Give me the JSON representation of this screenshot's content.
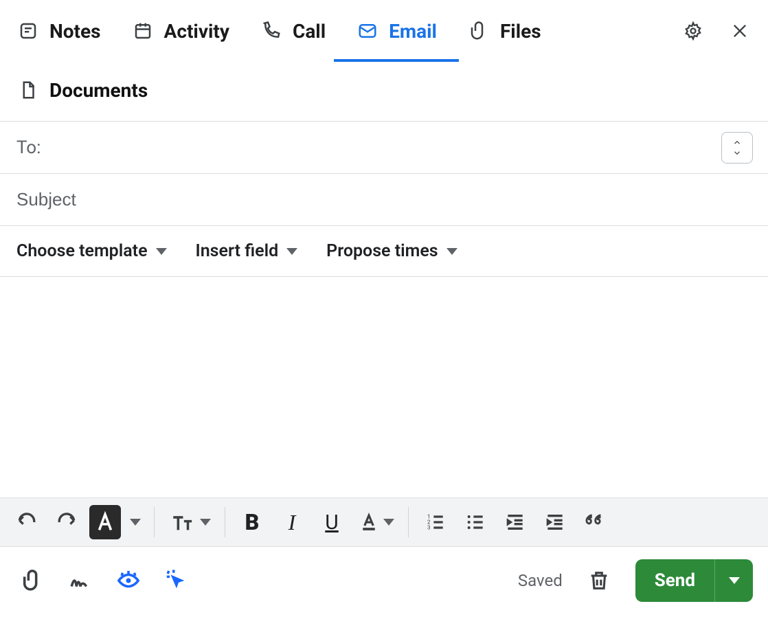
{
  "tabs": {
    "notes": "Notes",
    "activity": "Activity",
    "call": "Call",
    "email": "Email",
    "files": "Files",
    "documents": "Documents"
  },
  "fields": {
    "to_label": "To:",
    "to_value": "",
    "subject_placeholder": "Subject",
    "subject_value": ""
  },
  "actions": {
    "choose_template": "Choose template",
    "insert_field": "Insert field",
    "propose_times": "Propose times"
  },
  "status": "Saved",
  "send_label": "Send"
}
